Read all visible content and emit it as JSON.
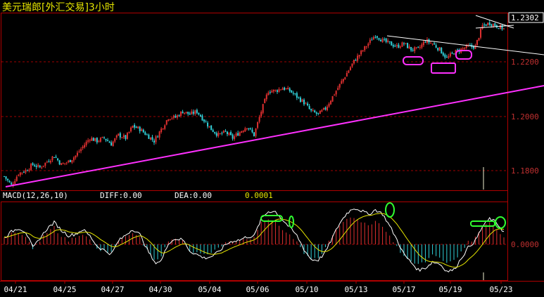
{
  "title": "美元瑞郎[外汇交易]3小时",
  "last_price": "1.2302",
  "indicator": {
    "name": "MACD(12,26,10)",
    "diff": "DIFF:0.00",
    "dea": "DEA:0.00",
    "value": "0.0001"
  },
  "colors": {
    "up": "#e03030",
    "down": "#30d0d8",
    "grid": "#a00000",
    "trend": "#ff30ff",
    "highlight": "#30ff30",
    "frame": "#b00000"
  },
  "chart_data": [
    {
      "type": "candlestick",
      "title": "",
      "x_ticks": [
        "04/21",
        "04/25",
        "04/27",
        "04/30",
        "05/04",
        "05/06",
        "05/10",
        "05/13",
        "05/17",
        "05/19",
        "05/23"
      ],
      "y_ticks": [
        "1.2200",
        "1.2000",
        "1.1800"
      ],
      "ylim": [
        1.175,
        1.234
      ],
      "close_path": [
        [
          0,
          1.179
        ],
        [
          4,
          1.176
        ],
        [
          8,
          1.18
        ],
        [
          12,
          1.181
        ],
        [
          16,
          1.183
        ],
        [
          20,
          1.182
        ],
        [
          24,
          1.184
        ],
        [
          28,
          1.186
        ],
        [
          32,
          1.183
        ],
        [
          36,
          1.184
        ],
        [
          40,
          1.186
        ],
        [
          44,
          1.189
        ],
        [
          48,
          1.192
        ],
        [
          52,
          1.191
        ],
        [
          56,
          1.192
        ],
        [
          60,
          1.19
        ],
        [
          64,
          1.193
        ],
        [
          68,
          1.192
        ],
        [
          72,
          1.196
        ],
        [
          76,
          1.195
        ],
        [
          80,
          1.193
        ],
        [
          84,
          1.191
        ],
        [
          88,
          1.195
        ],
        [
          92,
          1.199
        ],
        [
          96,
          1.199
        ],
        [
          100,
          1.201
        ],
        [
          104,
          1.2
        ],
        [
          108,
          1.201
        ],
        [
          112,
          1.198
        ],
        [
          116,
          1.195
        ],
        [
          120,
          1.193
        ],
        [
          124,
          1.194
        ],
        [
          128,
          1.192
        ],
        [
          132,
          1.194
        ],
        [
          136,
          1.196
        ],
        [
          140,
          1.193
        ],
        [
          144,
          1.201
        ],
        [
          148,
          1.208
        ],
        [
          152,
          1.208
        ],
        [
          156,
          1.209
        ],
        [
          160,
          1.208
        ],
        [
          164,
          1.206
        ],
        [
          168,
          1.204
        ],
        [
          172,
          1.201
        ],
        [
          176,
          1.2
        ],
        [
          180,
          1.202
        ],
        [
          184,
          1.206
        ],
        [
          188,
          1.21
        ],
        [
          192,
          1.214
        ],
        [
          196,
          1.218
        ],
        [
          200,
          1.221
        ],
        [
          204,
          1.224
        ],
        [
          208,
          1.227
        ],
        [
          212,
          1.225
        ],
        [
          216,
          1.224
        ],
        [
          220,
          1.223
        ],
        [
          224,
          1.224
        ],
        [
          228,
          1.222
        ],
        [
          232,
          1.222
        ],
        [
          236,
          1.225
        ],
        [
          240,
          1.224
        ],
        [
          244,
          1.222
        ],
        [
          248,
          1.219
        ],
        [
          252,
          1.221
        ],
        [
          256,
          1.222
        ],
        [
          260,
          1.223
        ],
        [
          264,
          1.223
        ],
        [
          268,
          1.23
        ],
        [
          272,
          1.231
        ],
        [
          276,
          1.23
        ],
        [
          280,
          1.229
        ]
      ],
      "macd_hist_path": [
        [
          0,
          0.3
        ],
        [
          4,
          0.5
        ],
        [
          8,
          0.6
        ],
        [
          12,
          0.4
        ],
        [
          16,
          -0.3
        ],
        [
          20,
          0.2
        ],
        [
          24,
          0.6
        ],
        [
          28,
          0.8
        ],
        [
          32,
          0.4
        ],
        [
          36,
          0.2
        ],
        [
          40,
          0.3
        ],
        [
          44,
          0.5
        ],
        [
          48,
          0.2
        ],
        [
          52,
          -0.2
        ],
        [
          56,
          -0.3
        ],
        [
          60,
          -0.4
        ],
        [
          64,
          0.2
        ],
        [
          68,
          0.4
        ],
        [
          72,
          0.6
        ],
        [
          76,
          0.3
        ],
        [
          80,
          -0.3
        ],
        [
          84,
          -0.8
        ],
        [
          88,
          -0.6
        ],
        [
          92,
          0.2
        ],
        [
          96,
          0.3
        ],
        [
          100,
          0.2
        ],
        [
          104,
          -0.3
        ],
        [
          108,
          -0.4
        ],
        [
          112,
          -0.5
        ],
        [
          116,
          -0.4
        ],
        [
          120,
          -0.2
        ],
        [
          124,
          0.1
        ],
        [
          128,
          0.2
        ],
        [
          132,
          0.2
        ],
        [
          136,
          0.3
        ],
        [
          140,
          0.3
        ],
        [
          144,
          1.0
        ],
        [
          148,
          1.2
        ],
        [
          152,
          1.1
        ],
        [
          156,
          0.7
        ],
        [
          160,
          0.4
        ],
        [
          164,
          0.1
        ],
        [
          168,
          -0.4
        ],
        [
          172,
          -0.7
        ],
        [
          176,
          -0.6
        ],
        [
          180,
          -0.2
        ],
        [
          184,
          0.4
        ],
        [
          188,
          0.9
        ],
        [
          192,
          1.2
        ],
        [
          196,
          1.3
        ],
        [
          200,
          1.1
        ],
        [
          204,
          0.9
        ],
        [
          208,
          1.1
        ],
        [
          212,
          0.9
        ],
        [
          216,
          0.4
        ],
        [
          220,
          -0.1
        ],
        [
          224,
          -0.6
        ],
        [
          228,
          -0.8
        ],
        [
          232,
          -1.0
        ],
        [
          236,
          -0.8
        ],
        [
          240,
          -0.5
        ],
        [
          244,
          -0.6
        ],
        [
          248,
          -0.9
        ],
        [
          252,
          -0.8
        ],
        [
          256,
          -0.3
        ],
        [
          260,
          0.1
        ],
        [
          264,
          0.3
        ],
        [
          268,
          0.8
        ],
        [
          272,
          1.0
        ],
        [
          276,
          0.7
        ],
        [
          280,
          0.3
        ]
      ]
    }
  ]
}
